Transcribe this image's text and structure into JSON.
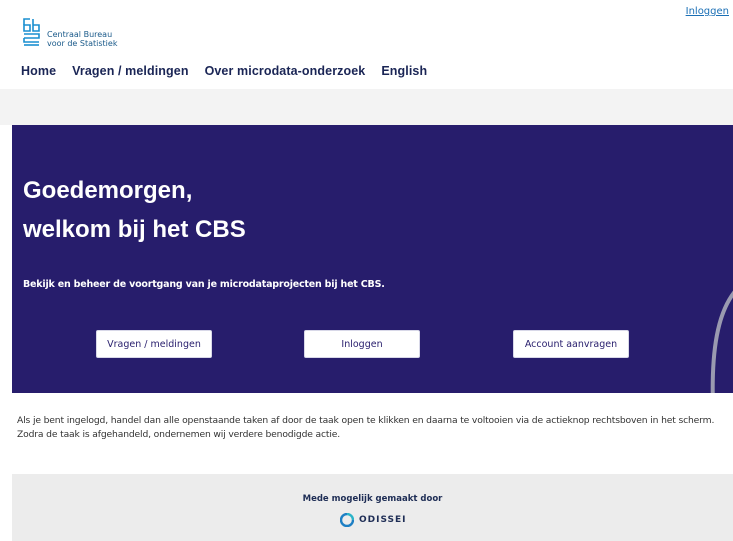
{
  "header": {
    "login_link": "Inloggen",
    "logo": {
      "line1": "Centraal Bureau",
      "line2": "voor de Statistiek"
    }
  },
  "nav": {
    "items": [
      {
        "label": "Home"
      },
      {
        "label": "Vragen / meldingen"
      },
      {
        "label": "Over microdata-onderzoek"
      },
      {
        "label": "English"
      }
    ]
  },
  "hero": {
    "greeting_line1": "Goedemorgen,",
    "greeting_line2": "welkom bij het CBS",
    "lead": "Bekijk en beheer de voortgang van je microdataprojecten bij het CBS.",
    "buttons": {
      "questions": "Vragen / meldingen",
      "login": "Inloggen",
      "request_account": "Account aanvragen"
    }
  },
  "info": {
    "line1": "Als je bent ingelogd, handel dan alle openstaande taken af door de taak open te klikken en daarna te voltooien via de actieknop rechtsboven in het scherm.",
    "line2": "Zodra de taak is afgehandeld, ondernemen wij verdere benodigde actie."
  },
  "footer": {
    "made_possible": "Mede mogelijk gemaakt door",
    "partner": "ODISSEI"
  },
  "colors": {
    "hero_bg": "#271d6c",
    "nav_text": "#1a2555",
    "link": "#1a6fb5",
    "logo_blue": "#1a8fd0"
  }
}
